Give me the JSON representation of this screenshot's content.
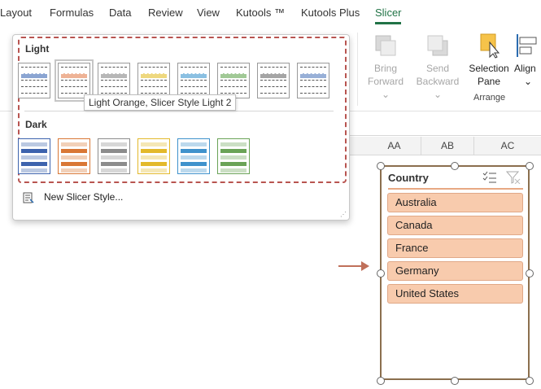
{
  "tabs": [
    "Layout",
    "Formulas",
    "Data",
    "Review",
    "View",
    "Kutools ™",
    "Kutools Plus",
    "Slicer"
  ],
  "ribbon": {
    "bring_forward": [
      "Bring",
      "Forward ⌄"
    ],
    "send_backward": [
      "Send",
      "Backward ⌄"
    ],
    "selection_pane": [
      "Selection",
      "Pane"
    ],
    "align": [
      "Align",
      "⌄"
    ],
    "group_label": "Arrange"
  },
  "gallery": {
    "light_label": "Light",
    "dark_label": "Dark",
    "new_style_label": "New Slicer Style...",
    "tooltip": "Light Orange, Slicer Style Light 2",
    "light_colors": [
      "#5b7fbf",
      "#e8946a",
      "#9a9a9a",
      "#e8c84a",
      "#5ba6d6",
      "#7ab36b",
      "#7f7f7f",
      "#6d8fc7"
    ],
    "dark_colors": [
      "#3d63ad",
      "#d97735",
      "#8c8c8c",
      "#e3b92b",
      "#3f92cc",
      "#6aa357"
    ]
  },
  "columns": [
    "AA",
    "AB",
    "AC"
  ],
  "slicer": {
    "title": "Country",
    "items": [
      "Australia",
      "Canada",
      "France",
      "Germany",
      "United States"
    ],
    "accent": "#f8cbad"
  }
}
